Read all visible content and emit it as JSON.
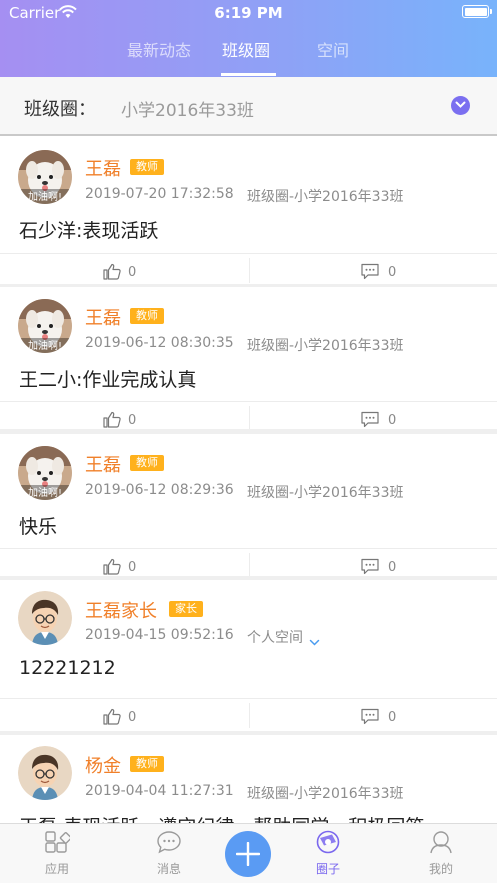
{
  "status_bar": {
    "carrier": "Carrier",
    "time": "6:19 PM"
  },
  "tabs": [
    {
      "label": "最新动态",
      "active": false
    },
    {
      "label": "班级圈",
      "active": true
    },
    {
      "label": "空间",
      "active": false
    }
  ],
  "selector": {
    "label": "班级圈：",
    "value": "小学2016年33班"
  },
  "posts": [
    {
      "name": "王磊",
      "role": "教师",
      "time": "2019-07-20 17:32:58",
      "scope": "班级圈-小学2016年33班",
      "content": "石少洋:表现活跃",
      "likes": "0",
      "comments": "0",
      "avatar_caption": "加油啊!"
    },
    {
      "name": "王磊",
      "role": "教师",
      "time": "2019-06-12 08:30:35",
      "scope": "班级圈-小学2016年33班",
      "content": "王二小:作业完成认真",
      "likes": "0",
      "comments": "0",
      "avatar_caption": "加油啊!"
    },
    {
      "name": "王磊",
      "role": "教师",
      "time": "2019-06-12 08:29:36",
      "scope": "班级圈-小学2016年33班",
      "content": "快乐",
      "likes": "0",
      "comments": "0",
      "avatar_caption": "加油啊!"
    },
    {
      "name": "王磊家长",
      "role": "家长",
      "time": "2019-04-15 09:52:16",
      "scope": "个人空间",
      "content": "12221212",
      "likes": "0",
      "comments": "0"
    },
    {
      "name": "杨金",
      "role": "教师",
      "time": "2019-04-04 11:27:31",
      "scope": "班级圈-小学2016年33班",
      "content": "王磊:表现活跃，遵守纪律，帮助同学，积极回答"
    }
  ],
  "tabbar": [
    {
      "label": "应用",
      "icon": "apps-icon"
    },
    {
      "label": "消息",
      "icon": "message-icon"
    },
    {
      "label": "",
      "icon": "plus-icon"
    },
    {
      "label": "圈子",
      "icon": "circle-icon",
      "active": true
    },
    {
      "label": "我的",
      "icon": "profile-icon"
    }
  ],
  "colors": {
    "accent": "#7a67ee",
    "name": "#f0802a",
    "badge": "#ffb11c",
    "plus": "#5a9bf3"
  }
}
